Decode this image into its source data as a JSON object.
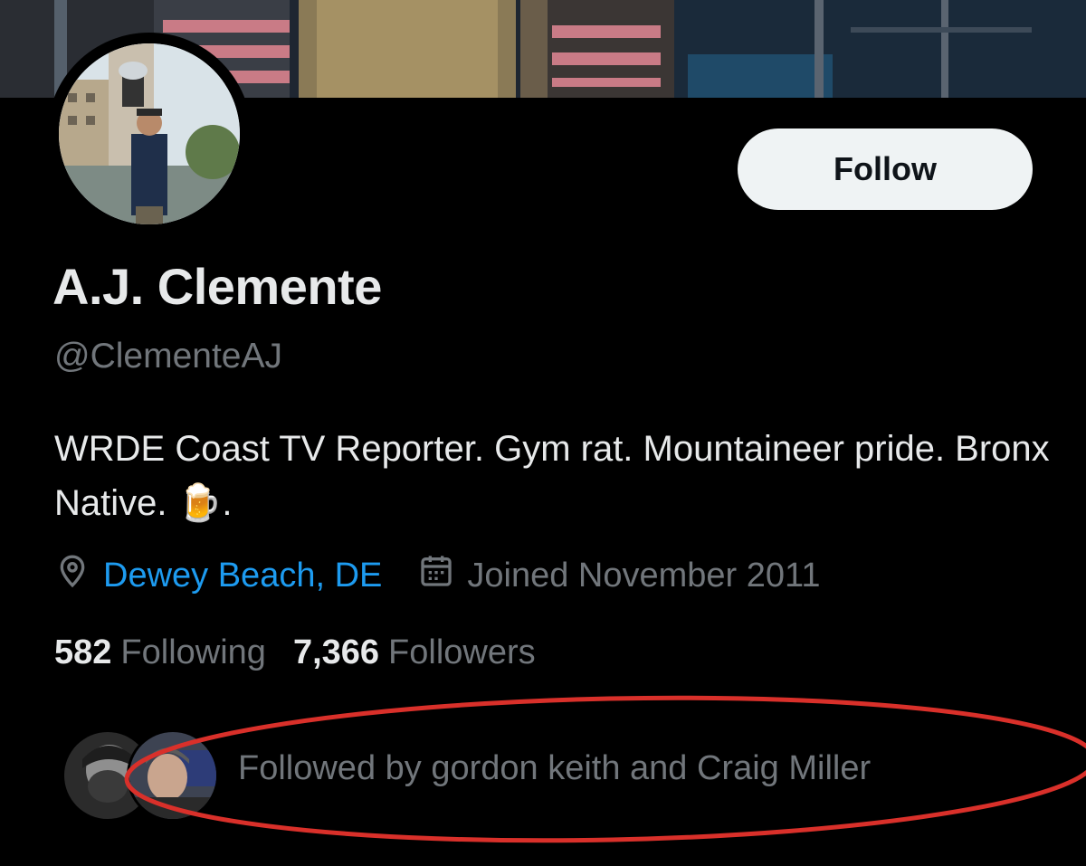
{
  "profile": {
    "display_name": "A.J. Clemente",
    "handle": "@ClementeAJ",
    "bio_text": "WRDE Coast TV Reporter. Gym rat. Mountaineer pride. Bronx Native. ",
    "bio_emoji": "🍺",
    "bio_end": ".",
    "location": "Dewey Beach, DE",
    "joined": "Joined November 2011"
  },
  "actions": {
    "follow_label": "Follow"
  },
  "stats": {
    "following_count": "582",
    "following_label": "Following",
    "followers_count": "7,366",
    "followers_label": "Followers"
  },
  "followed_by": {
    "text": "Followed by gordon keith and Craig Miller"
  },
  "colors": {
    "background": "#000000",
    "primary_text": "#e7e9ea",
    "secondary_text": "#71767b",
    "link": "#1d9bf0",
    "follow_button_bg": "#eff3f4",
    "annotation_red": "#d9302a"
  },
  "icons": {
    "location": "location-pin-icon",
    "calendar": "calendar-icon"
  }
}
